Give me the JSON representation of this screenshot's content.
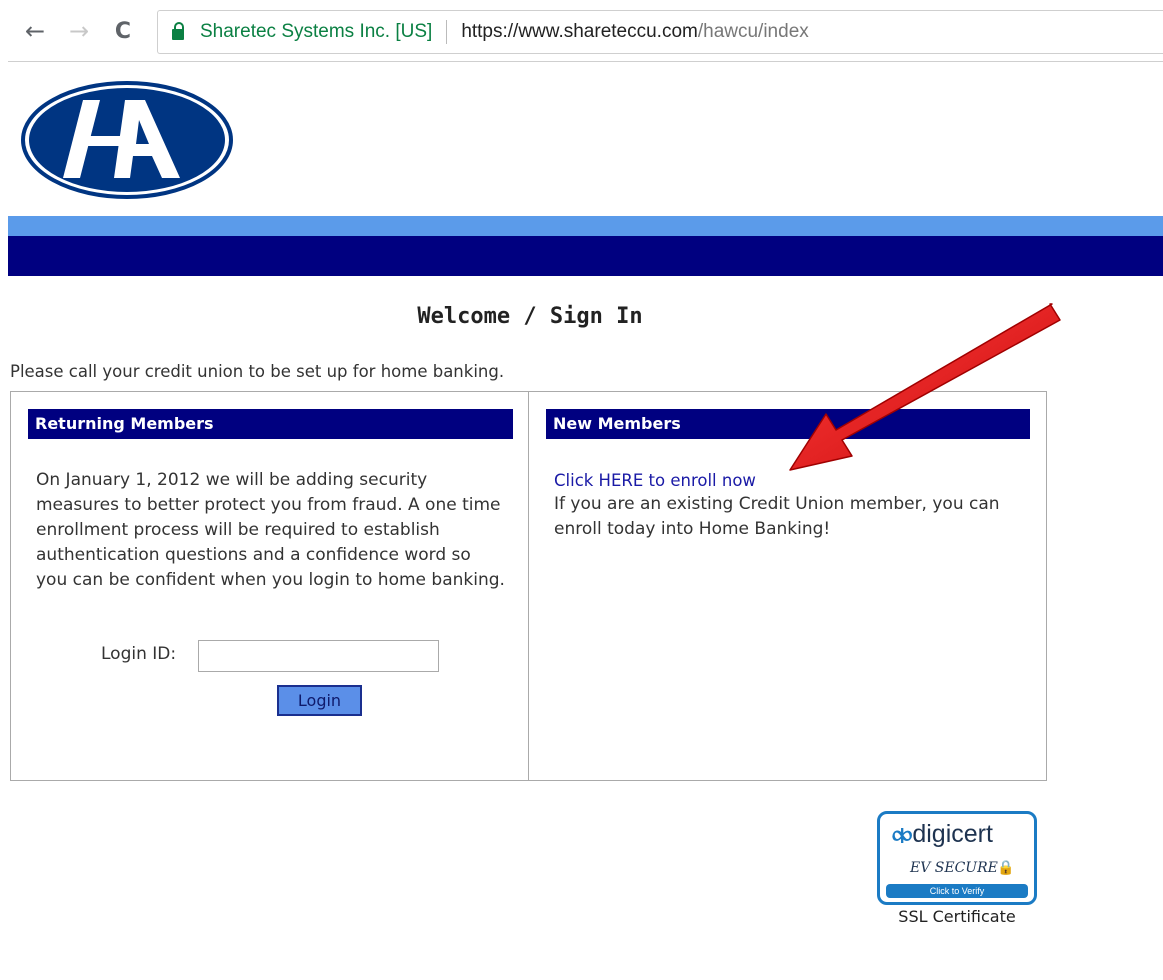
{
  "browser": {
    "back_icon": "←",
    "forward_icon": "→",
    "reload_icon": "C",
    "ev_name": "Sharetec Systems Inc. [US]",
    "url_host": "https://www.shareteccu.com",
    "url_path": "/hawcu/index"
  },
  "logo": {
    "text": "HA",
    "fill_color": "#003582"
  },
  "page": {
    "title": "Welcome / Sign In",
    "intro": "Please call your credit union to be set up for home banking."
  },
  "returning": {
    "header": "Returning Members",
    "body": "On January 1, 2012 we will be adding security measures to better protect you from fraud. A one time enrollment process will be required to establish authentication questions and a confidence word so you can be confident when you login to home banking.",
    "login_label": "Login ID:",
    "login_value": "",
    "login_button": "Login"
  },
  "new_members": {
    "header": "New Members",
    "enroll_link": "Click HERE to enroll now",
    "body": "If you are an existing Credit Union member, you can enroll today into Home Banking!"
  },
  "seal": {
    "brand": "digicert",
    "ev": "EV SECURE",
    "verify": "Click to Verify",
    "caption": "SSL Certificate"
  },
  "colors": {
    "band_light": "#5b9bea",
    "band_dark": "#000080",
    "annotation_arrow": "#e81414"
  }
}
